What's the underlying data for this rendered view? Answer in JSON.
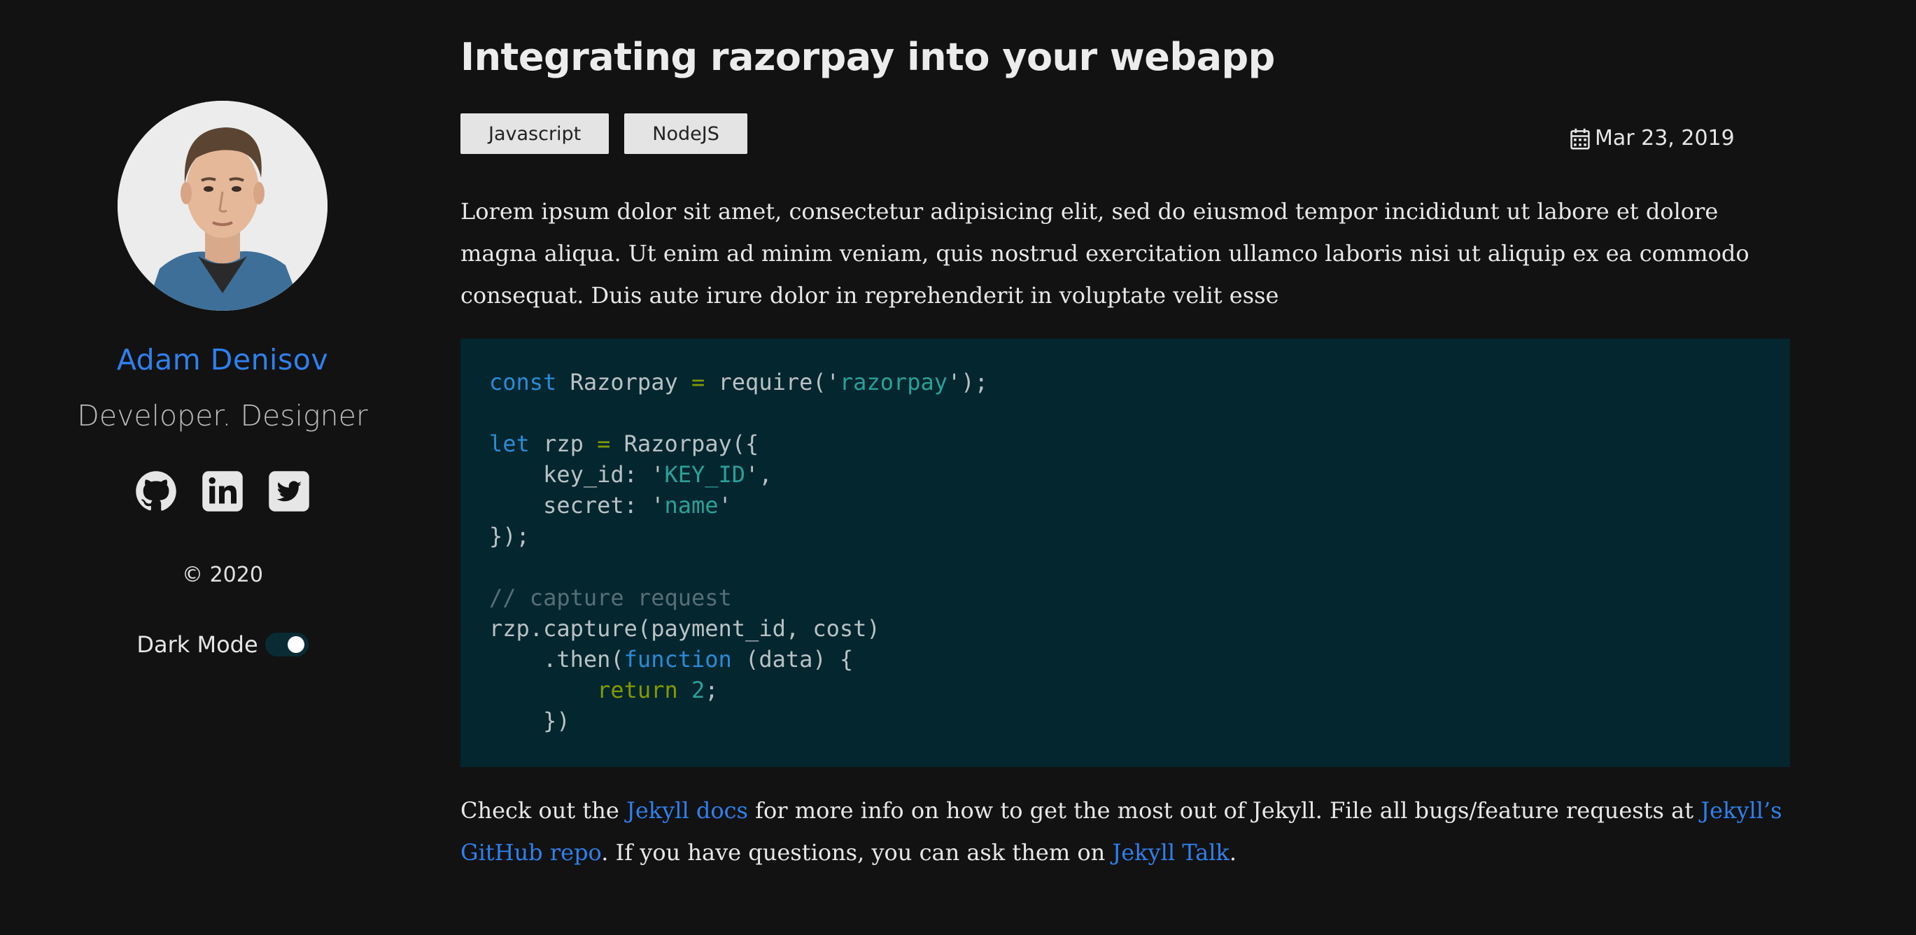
{
  "sidebar": {
    "name": "Adam Denisov",
    "tagline": "Developer. Designer",
    "social": [
      {
        "icon": "github-icon",
        "label": "GitHub"
      },
      {
        "icon": "linkedin-icon",
        "label": "LinkedIn"
      },
      {
        "icon": "twitter-icon",
        "label": "Twitter"
      }
    ],
    "copyright": "© 2020",
    "dark_mode_label": "Dark Mode",
    "dark_mode_on": true
  },
  "post": {
    "title": "Integrating razorpay into your webapp",
    "tags": [
      "Javascript",
      "NodeJS"
    ],
    "date": "Mar 23, 2019",
    "intro": "Lorem ipsum dolor sit amet, consectetur adipisicing elit, sed do eiusmod tempor incididunt ut labore et dolore magna aliqua. Ut enim ad minim veniam, quis nostrud exercitation ullamco laboris nisi ut aliquip ex ea commodo consequat. Duis aute irure dolor in reprehenderit in voluptate velit esse",
    "code": {
      "line1": {
        "kw": "const",
        "name": " Razorpay ",
        "op": "=",
        "call": " require('",
        "str": "razorpay",
        "end": "');"
      },
      "line3": {
        "kw": "let",
        "name": " rzp ",
        "op": "=",
        "call": " Razorpay({"
      },
      "line4": {
        "key": "    key_id: '",
        "str": "KEY_ID",
        "end": "',"
      },
      "line5": {
        "key": "    secret: '",
        "str": "name",
        "end": "'"
      },
      "line6": "});",
      "line8": "// capture request",
      "line9": "rzp.capture(payment_id, cost)",
      "line10": {
        "pre": "    .then(",
        "kw": "function",
        "post": " (data) {"
      },
      "line11": {
        "indent": "        ",
        "kw": "return",
        "num": " 2",
        "end": ";"
      },
      "line12": "    })"
    },
    "outro": {
      "t1": "Check out the ",
      "link1": "Jekyll docs",
      "t2": " for more info on how to get the most out of Jekyll. File all bugs/feature requests at ",
      "link2": "Jekyll’s GitHub repo",
      "t3": ". If you have questions, you can ask them on ",
      "link3": "Jekyll Talk",
      "t4": "."
    }
  },
  "colors": {
    "background": "#121212",
    "accent": "#2f80ed",
    "code_bg": "#03262f"
  }
}
